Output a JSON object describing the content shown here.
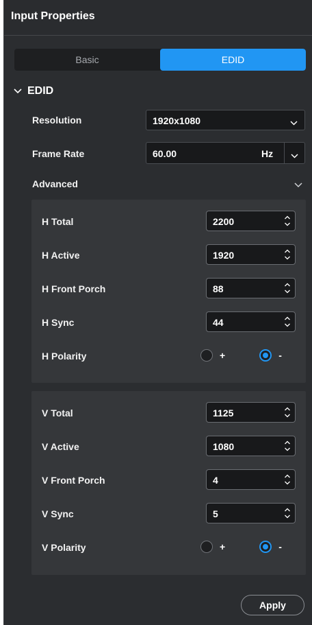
{
  "header": {
    "title": "Input Properties"
  },
  "tabs": [
    {
      "label": "Basic",
      "active": false
    },
    {
      "label": "EDID",
      "active": true
    }
  ],
  "edid": {
    "section_title": "EDID",
    "resolution": {
      "label": "Resolution",
      "value": "1920x1080"
    },
    "frame_rate": {
      "label": "Frame Rate",
      "value": "60.00",
      "unit": "Hz"
    },
    "advanced": {
      "label": "Advanced",
      "expanded": true
    },
    "horizontal": {
      "h_total": {
        "label": "H Total",
        "value": "2200"
      },
      "h_active": {
        "label": "H Active",
        "value": "1920"
      },
      "h_front_porch": {
        "label": "H Front Porch",
        "value": "88"
      },
      "h_sync": {
        "label": "H Sync",
        "value": "44"
      },
      "h_polarity": {
        "label": "H Polarity",
        "plus": "+",
        "minus": "-",
        "selected": "-"
      }
    },
    "vertical": {
      "v_total": {
        "label": "V Total",
        "value": "1125"
      },
      "v_active": {
        "label": "V Active",
        "value": "1080"
      },
      "v_front_porch": {
        "label": "V Front Porch",
        "value": "4"
      },
      "v_sync": {
        "label": "V Sync",
        "value": "5"
      },
      "v_polarity": {
        "label": "V Polarity",
        "plus": "+",
        "minus": "-",
        "selected": "-"
      }
    }
  },
  "footer": {
    "apply_label": "Apply"
  },
  "colors": {
    "accent": "#2196f3",
    "panel_bg": "#2b2d30",
    "group_bg": "#35373a",
    "input_bg": "#18191b"
  }
}
